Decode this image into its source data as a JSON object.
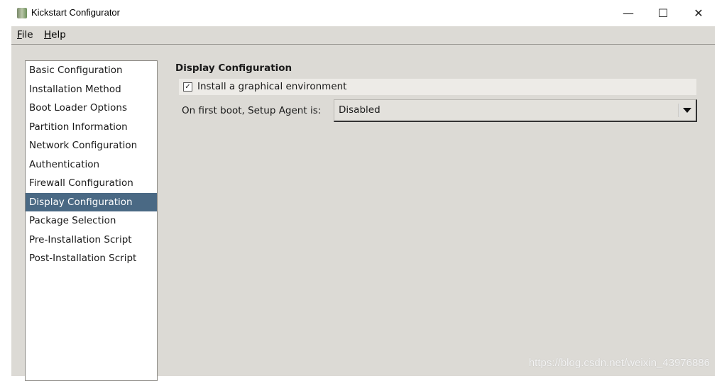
{
  "window": {
    "title": "Kickstart Configurator",
    "icon": "kickstart-app-icon",
    "controls": {
      "minimize": "—",
      "maximize": "☐",
      "close": "✕"
    }
  },
  "menubar": [
    {
      "label": "File",
      "mnemonic": "F",
      "rest": "ile"
    },
    {
      "label": "Help",
      "mnemonic": "H",
      "rest": "elp"
    }
  ],
  "sidebar": {
    "selected": "Display Configuration",
    "selected_color": "#4a6984",
    "items": [
      {
        "label": "Basic Configuration"
      },
      {
        "label": "Installation Method"
      },
      {
        "label": "Boot Loader Options"
      },
      {
        "label": "Partition Information"
      },
      {
        "label": "Network Configuration"
      },
      {
        "label": "Authentication"
      },
      {
        "label": "Firewall Configuration"
      },
      {
        "label": "Display Configuration"
      },
      {
        "label": "Package Selection"
      },
      {
        "label": "Pre-Installation Script"
      },
      {
        "label": "Post-Installation Script"
      }
    ]
  },
  "main": {
    "heading": "Display Configuration",
    "install_graphical": {
      "label": "Install a graphical environment",
      "checked": true,
      "mark": "✓"
    },
    "setup_agent": {
      "label": "On first boot, Setup Agent is:",
      "value": "Disabled"
    }
  },
  "watermark": "https://blog.csdn.net/weixin_43976886"
}
